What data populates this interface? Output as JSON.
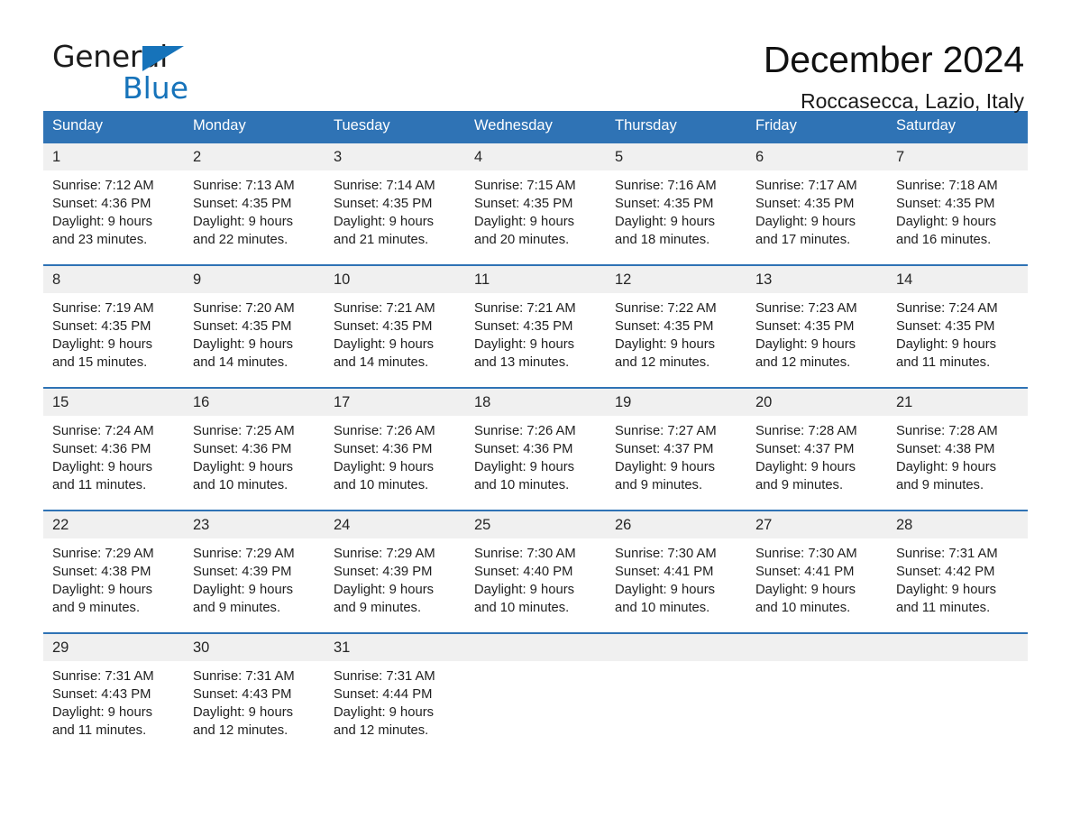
{
  "brand": {
    "word_one": "General",
    "word_two": "Blue",
    "triangle_icon": "triangle-icon",
    "accent_color": "#1673ba"
  },
  "header": {
    "title": "December 2024",
    "location": "Roccasecca, Lazio, Italy"
  },
  "theme": {
    "header_blue": "#2f73b5",
    "row_rule_blue": "#2f73b5",
    "daynum_band": "#f0f0f0",
    "page_background": "#ffffff"
  },
  "weekdays": [
    "Sunday",
    "Monday",
    "Tuesday",
    "Wednesday",
    "Thursday",
    "Friday",
    "Saturday"
  ],
  "weeks": [
    [
      {
        "day": "1",
        "info": "Sunrise: 7:12 AM\nSunset: 4:36 PM\nDaylight: 9 hours and 23 minutes."
      },
      {
        "day": "2",
        "info": "Sunrise: 7:13 AM\nSunset: 4:35 PM\nDaylight: 9 hours and 22 minutes."
      },
      {
        "day": "3",
        "info": "Sunrise: 7:14 AM\nSunset: 4:35 PM\nDaylight: 9 hours and 21 minutes."
      },
      {
        "day": "4",
        "info": "Sunrise: 7:15 AM\nSunset: 4:35 PM\nDaylight: 9 hours and 20 minutes."
      },
      {
        "day": "5",
        "info": "Sunrise: 7:16 AM\nSunset: 4:35 PM\nDaylight: 9 hours and 18 minutes."
      },
      {
        "day": "6",
        "info": "Sunrise: 7:17 AM\nSunset: 4:35 PM\nDaylight: 9 hours and 17 minutes."
      },
      {
        "day": "7",
        "info": "Sunrise: 7:18 AM\nSunset: 4:35 PM\nDaylight: 9 hours and 16 minutes."
      }
    ],
    [
      {
        "day": "8",
        "info": "Sunrise: 7:19 AM\nSunset: 4:35 PM\nDaylight: 9 hours and 15 minutes."
      },
      {
        "day": "9",
        "info": "Sunrise: 7:20 AM\nSunset: 4:35 PM\nDaylight: 9 hours and 14 minutes."
      },
      {
        "day": "10",
        "info": "Sunrise: 7:21 AM\nSunset: 4:35 PM\nDaylight: 9 hours and 14 minutes."
      },
      {
        "day": "11",
        "info": "Sunrise: 7:21 AM\nSunset: 4:35 PM\nDaylight: 9 hours and 13 minutes."
      },
      {
        "day": "12",
        "info": "Sunrise: 7:22 AM\nSunset: 4:35 PM\nDaylight: 9 hours and 12 minutes."
      },
      {
        "day": "13",
        "info": "Sunrise: 7:23 AM\nSunset: 4:35 PM\nDaylight: 9 hours and 12 minutes."
      },
      {
        "day": "14",
        "info": "Sunrise: 7:24 AM\nSunset: 4:35 PM\nDaylight: 9 hours and 11 minutes."
      }
    ],
    [
      {
        "day": "15",
        "info": "Sunrise: 7:24 AM\nSunset: 4:36 PM\nDaylight: 9 hours and 11 minutes."
      },
      {
        "day": "16",
        "info": "Sunrise: 7:25 AM\nSunset: 4:36 PM\nDaylight: 9 hours and 10 minutes."
      },
      {
        "day": "17",
        "info": "Sunrise: 7:26 AM\nSunset: 4:36 PM\nDaylight: 9 hours and 10 minutes."
      },
      {
        "day": "18",
        "info": "Sunrise: 7:26 AM\nSunset: 4:36 PM\nDaylight: 9 hours and 10 minutes."
      },
      {
        "day": "19",
        "info": "Sunrise: 7:27 AM\nSunset: 4:37 PM\nDaylight: 9 hours and 9 minutes."
      },
      {
        "day": "20",
        "info": "Sunrise: 7:28 AM\nSunset: 4:37 PM\nDaylight: 9 hours and 9 minutes."
      },
      {
        "day": "21",
        "info": "Sunrise: 7:28 AM\nSunset: 4:38 PM\nDaylight: 9 hours and 9 minutes."
      }
    ],
    [
      {
        "day": "22",
        "info": "Sunrise: 7:29 AM\nSunset: 4:38 PM\nDaylight: 9 hours and 9 minutes."
      },
      {
        "day": "23",
        "info": "Sunrise: 7:29 AM\nSunset: 4:39 PM\nDaylight: 9 hours and 9 minutes."
      },
      {
        "day": "24",
        "info": "Sunrise: 7:29 AM\nSunset: 4:39 PM\nDaylight: 9 hours and 9 minutes."
      },
      {
        "day": "25",
        "info": "Sunrise: 7:30 AM\nSunset: 4:40 PM\nDaylight: 9 hours and 10 minutes."
      },
      {
        "day": "26",
        "info": "Sunrise: 7:30 AM\nSunset: 4:41 PM\nDaylight: 9 hours and 10 minutes."
      },
      {
        "day": "27",
        "info": "Sunrise: 7:30 AM\nSunset: 4:41 PM\nDaylight: 9 hours and 10 minutes."
      },
      {
        "day": "28",
        "info": "Sunrise: 7:31 AM\nSunset: 4:42 PM\nDaylight: 9 hours and 11 minutes."
      }
    ],
    [
      {
        "day": "29",
        "info": "Sunrise: 7:31 AM\nSunset: 4:43 PM\nDaylight: 9 hours and 11 minutes."
      },
      {
        "day": "30",
        "info": "Sunrise: 7:31 AM\nSunset: 4:43 PM\nDaylight: 9 hours and 12 minutes."
      },
      {
        "day": "31",
        "info": "Sunrise: 7:31 AM\nSunset: 4:44 PM\nDaylight: 9 hours and 12 minutes."
      },
      {
        "day": "",
        "info": ""
      },
      {
        "day": "",
        "info": ""
      },
      {
        "day": "",
        "info": ""
      },
      {
        "day": "",
        "info": ""
      }
    ]
  ]
}
